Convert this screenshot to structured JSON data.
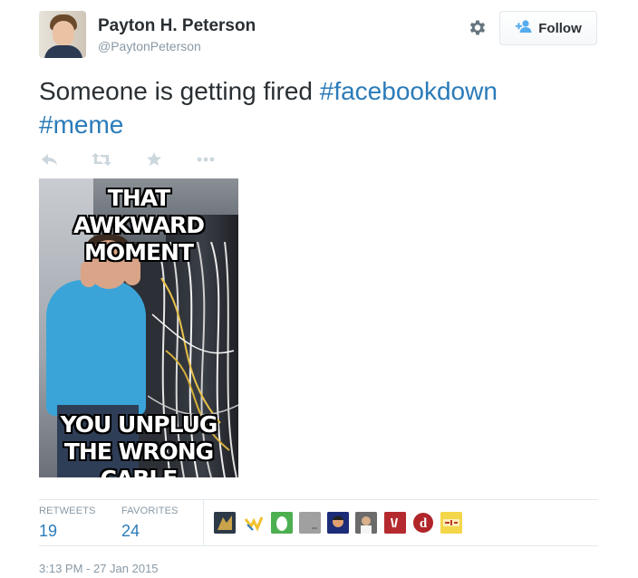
{
  "user": {
    "name": "Payton H. Peterson",
    "handle": "@PaytonPeterson"
  },
  "follow_button": {
    "label": "Follow"
  },
  "tweet": {
    "text_before": "Someone is getting fired ",
    "hashtag1": "#facebookdown",
    "hashtag2": "#meme"
  },
  "meme": {
    "top_text": "THAT AWKWARD MOMENT",
    "bottom_text": "YOU UNPLUG THE WRONG CABLE"
  },
  "stats": {
    "retweets_label": "RETWEETS",
    "retweets_count": "19",
    "favorites_label": "FAVORITES",
    "favorites_count": "24"
  },
  "favoriters": [
    "avatar-1",
    "avatar-2",
    "avatar-3",
    "avatar-4",
    "avatar-5",
    "avatar-6",
    "avatar-7",
    "avatar-8",
    "avatar-9"
  ],
  "timestamp": "3:13 PM - 27 Jan 2015",
  "icons": {
    "settings": "gear-icon",
    "follow": "add-user-icon",
    "reply": "reply-icon",
    "retweet": "retweet-icon",
    "favorite": "star-icon",
    "more": "more-icon"
  },
  "colors": {
    "link": "#2b7bb9",
    "muted": "#8899a6",
    "text": "#292f33"
  }
}
